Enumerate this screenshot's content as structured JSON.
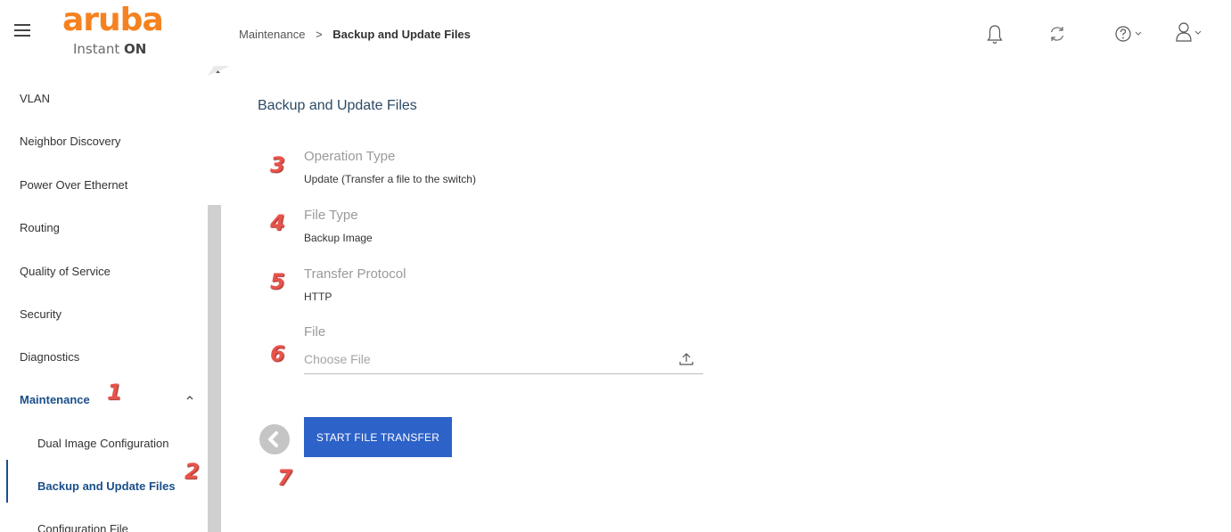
{
  "header": {
    "logo_word": "aruba",
    "logo_sub_prefix": "Instant ",
    "logo_sub_brand": "ON",
    "breadcrumb": {
      "parent": "Maintenance",
      "separator": ">",
      "current": "Backup and Update Files"
    },
    "icons": [
      "hamburger-menu-icon",
      "bell-icon",
      "refresh-icon",
      "help-icon",
      "user-icon",
      "chevron-down-icon"
    ]
  },
  "sidebar": {
    "items": [
      {
        "label": "VLAN"
      },
      {
        "label": "Neighbor Discovery"
      },
      {
        "label": "Power Over Ethernet"
      },
      {
        "label": "Routing"
      },
      {
        "label": "Quality of Service"
      },
      {
        "label": "Security"
      },
      {
        "label": "Diagnostics"
      },
      {
        "label": "Maintenance"
      }
    ],
    "subitems": [
      {
        "label": "Dual Image Configuration"
      },
      {
        "label": "Backup and Update Files"
      },
      {
        "label": "Configuration File"
      }
    ]
  },
  "annotations": [
    "1",
    "2",
    "3",
    "4",
    "5",
    "6",
    "7"
  ],
  "main": {
    "title": "Backup and Update Files",
    "operation": {
      "label": "Operation Type",
      "value": "Update (Transfer a file to the switch)"
    },
    "file_type": {
      "label": "File Type",
      "value": "Backup Image"
    },
    "protocol": {
      "label": "Transfer Protocol",
      "value": "HTTP"
    },
    "file": {
      "label": "File",
      "placeholder": "Choose File"
    },
    "start_button": "START FILE TRANSFER"
  },
  "colors": {
    "brand_orange": "#f58220",
    "primary_blue": "#2d62c8",
    "nav_active": "#1a4e8a",
    "annotation_red": "#e8534b"
  }
}
